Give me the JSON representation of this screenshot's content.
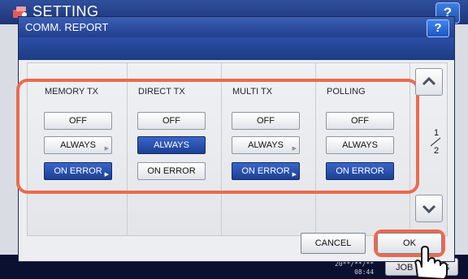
{
  "app": {
    "title": "SETTING",
    "help_label": "?",
    "time_top": "20**/**/**",
    "time": "08:44",
    "jobs_label": "JOB STATUS"
  },
  "dialog": {
    "title": "COMM. REPORT",
    "help_label": "?",
    "columns": [
      {
        "label": "MEMORY TX",
        "off": "OFF",
        "always": "ALWAYS",
        "on_error": "ON ERROR",
        "selected": "ON ERROR"
      },
      {
        "label": "DIRECT TX",
        "off": "OFF",
        "always": "ALWAYS",
        "on_error": "ON ERROR",
        "selected": "ALWAYS"
      },
      {
        "label": "MULTI TX",
        "off": "OFF",
        "always": "ALWAYS",
        "on_error": "ON ERROR",
        "selected": "ON ERROR"
      },
      {
        "label": "POLLING",
        "off": "OFF",
        "always": "ALWAYS",
        "on_error": "ON ERROR",
        "selected": "ON ERROR"
      }
    ],
    "page": {
      "current": "1",
      "total": "2"
    },
    "cancel_label": "CANCEL",
    "ok_label": "OK"
  },
  "colors": {
    "accent_blue": "#1c3f94",
    "highlight": "#ec6a4f",
    "title_bar": "#223f8c"
  }
}
